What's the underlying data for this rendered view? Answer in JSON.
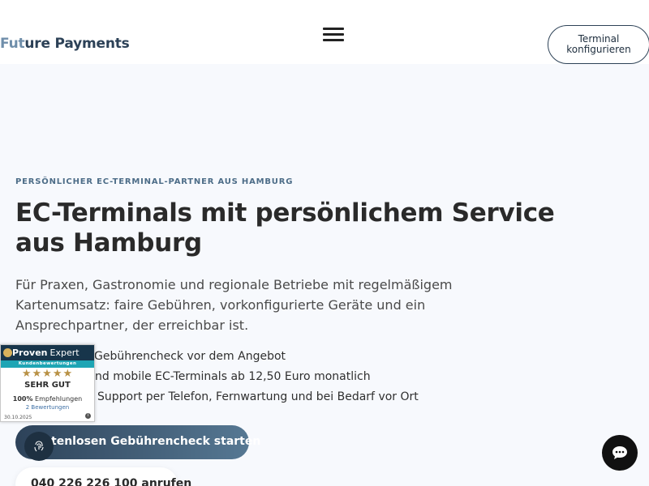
{
  "header": {
    "logo_part1": "Fut",
    "logo_part2": "ure Payments",
    "cta_line1": "Terminal",
    "cta_line2": "konfigurieren"
  },
  "hero": {
    "kicker": "PERSÖNLICHER EC-TERMINAL-PARTNER AUS HAMBURG",
    "headline": "EC-Terminals mit persönlichem Service aus Hamburg",
    "intro": "Für Praxen, Gastronomie und regionale Betriebe mit regelmäßigem Kartenumsatz: faire Gebühren, vorkonfigurierte Geräte und ein Ansprechpartner, der erreichbar ist.",
    "features": [
      "Gebührencheck vor dem Angebot",
      "nd mobile EC-Terminals ab 12,50 Euro monatlich",
      "Support per Telefon, Fernwartung und bei Bedarf vor Ort"
    ],
    "cta_primary": "tenlosen Gebührencheck starten",
    "cta_phone": "040 226 226 100 anrufen"
  },
  "proven_expert": {
    "brand_bold": "Proven",
    "brand_light": "Expert",
    "subtitle": "Kundenbewertungen",
    "stars": "★★★★★",
    "grade": "SEHR GUT",
    "recommend_pct": "100%",
    "recommend_label": "Empfehlungen",
    "reviews": "2 Bewertungen",
    "date": "30.10.2025",
    "info_glyph": "i"
  },
  "icons": {
    "menu": "hamburger-icon",
    "chat": "chat-bubble-icon",
    "fingerprint": "fingerprint-icon"
  },
  "colors": {
    "accent_dark": "#2d4259",
    "accent_light": "#567893",
    "logo_light": "#6f8eaa",
    "background": "#f7f9fd",
    "badge_teal": "#1ea5b4",
    "star_gold": "#b89145"
  }
}
